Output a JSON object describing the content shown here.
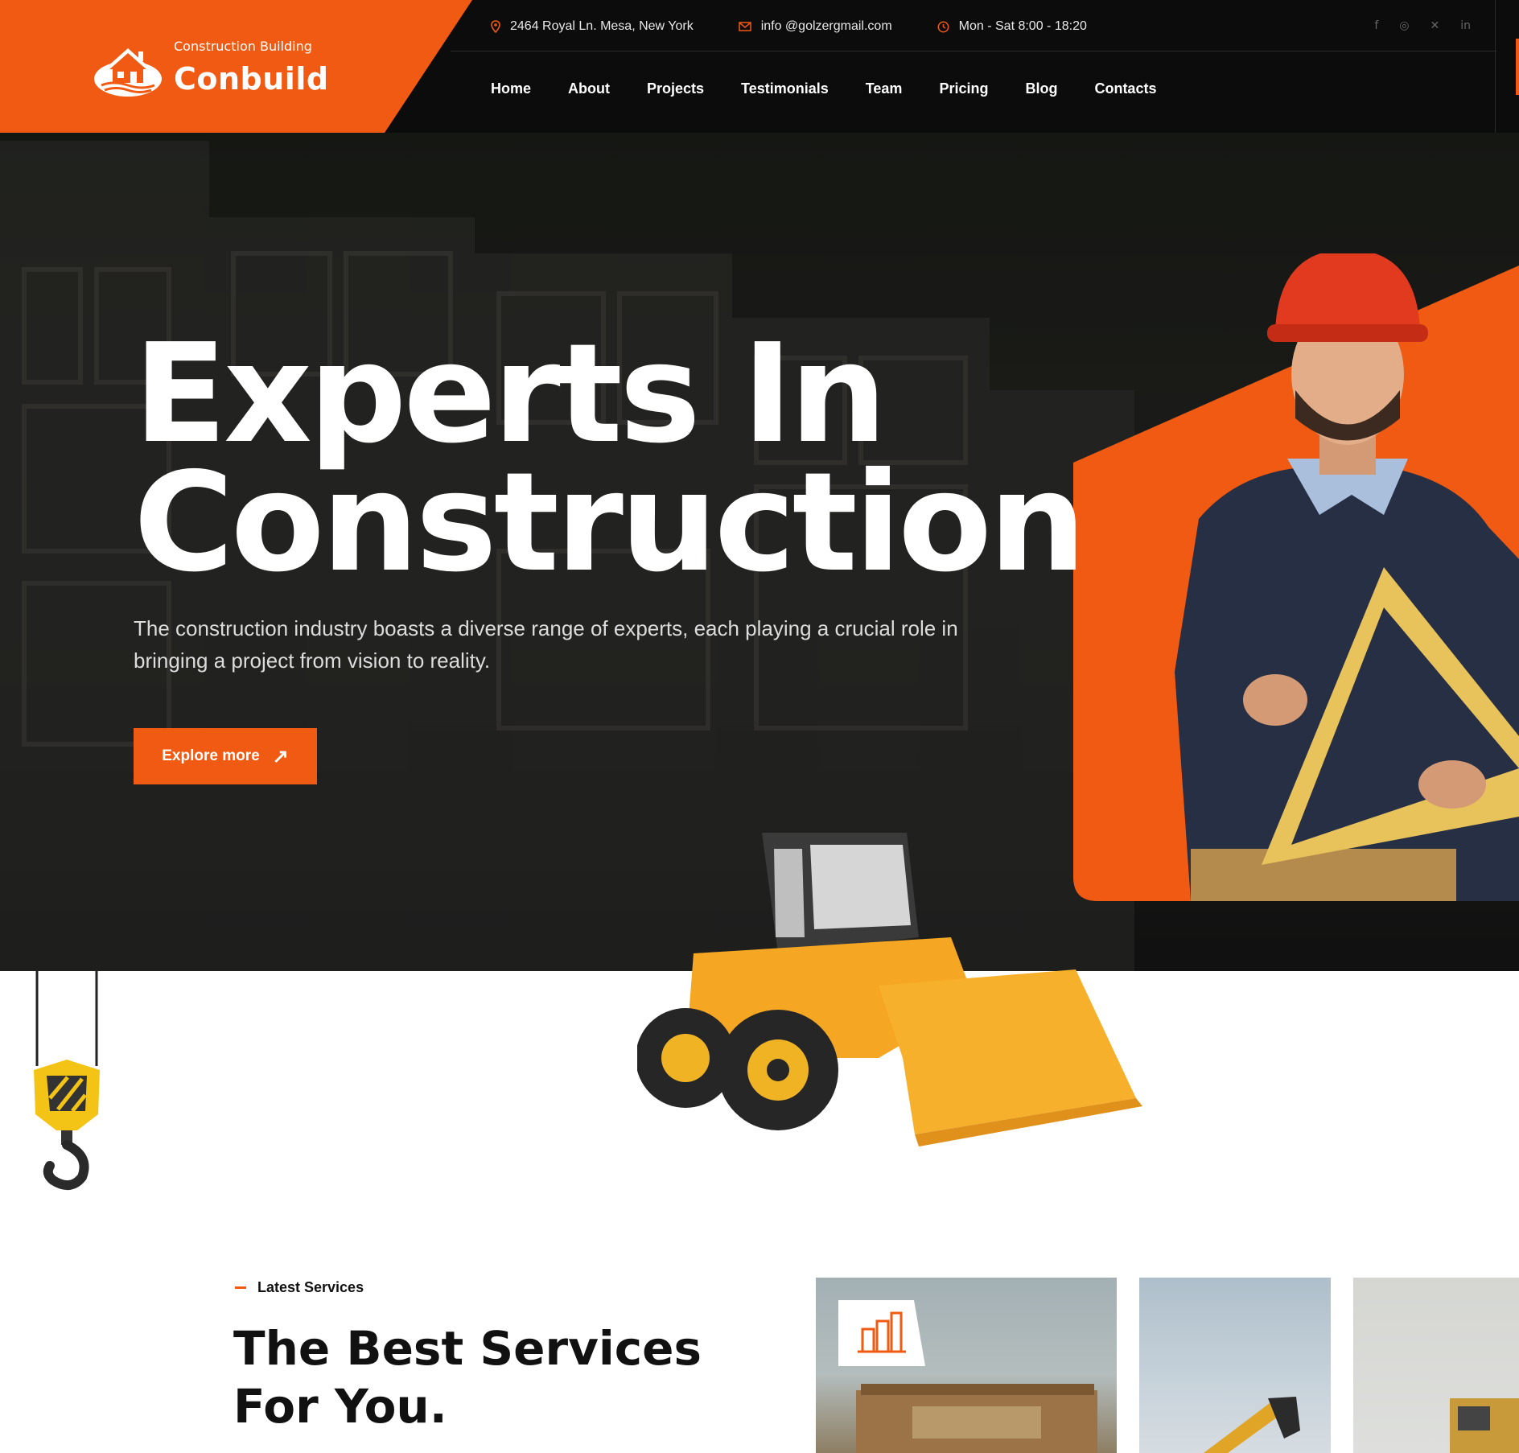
{
  "brand": {
    "tagline": "Construction Building",
    "name": "Conbuild",
    "accent": "#f15a12"
  },
  "contact": {
    "address": "2464 Royal Ln. Mesa, New York",
    "email": "info @golzergmail.com",
    "hours": "Mon - Sat 8:00 - 18:20"
  },
  "social": [
    {
      "icon": "facebook-icon",
      "glyph": "f"
    },
    {
      "icon": "instagram-icon",
      "glyph": "◎"
    },
    {
      "icon": "x-icon",
      "glyph": "✕"
    },
    {
      "icon": "linkedin-icon",
      "glyph": "in"
    }
  ],
  "nav": [
    "Home",
    "About",
    "Projects",
    "Testimonials",
    "Team",
    "Pricing",
    "Blog",
    "Contacts"
  ],
  "hero": {
    "title_line1": "Experts In",
    "title_line2": "Construction",
    "subtitle": "The construction industry boasts a diverse range of experts, each playing a crucial role in bringing a project from vision to reality.",
    "cta_label": "Explore more",
    "cta_icon": "arrow-up-right-icon"
  },
  "services": {
    "eyebrow": "Latest Services",
    "title_line1": "The Best Services",
    "title_line2": "For You."
  }
}
